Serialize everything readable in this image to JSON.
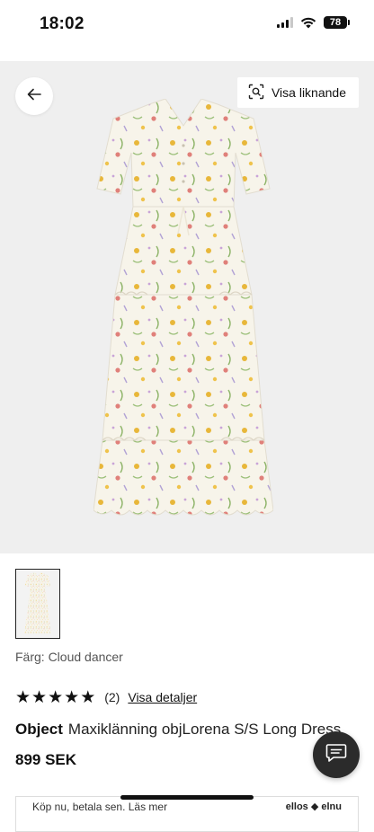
{
  "status_bar": {
    "time": "18:02",
    "battery": "78"
  },
  "product_view": {
    "similar_button_label": "Visa liknande"
  },
  "details": {
    "color_label": "Färg: Cloud dancer",
    "rating_count": "(2)",
    "rating_link": "Visa detaljer",
    "rating_stars": 5,
    "brand": "Object",
    "product_name": "Maxiklänning objLorena S/S Long Dress",
    "price": "899 SEK"
  },
  "promo": {
    "text": "Köp nu, betala sen. Läs mer",
    "logos": "ellos ◆ elnu"
  },
  "icons": [
    "back-arrow-icon",
    "camera-search-icon",
    "chat-icon",
    "signal-icon",
    "wifi-icon",
    "battery-icon"
  ]
}
